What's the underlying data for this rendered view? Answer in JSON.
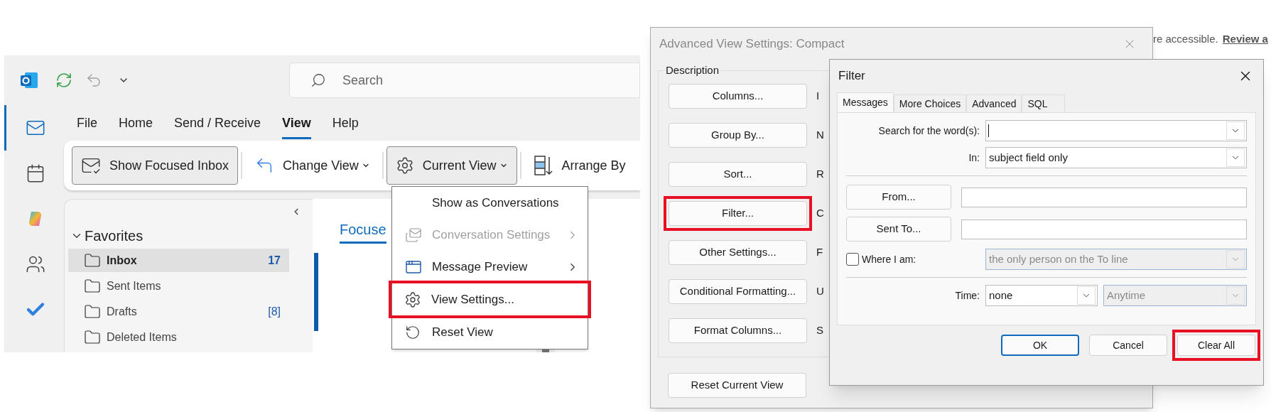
{
  "outlook": {
    "search": {
      "placeholder": "Search"
    },
    "nav_rail": [
      {
        "kind": "mail",
        "selected": true
      },
      {
        "kind": "calendar",
        "selected": false
      },
      {
        "kind": "copilot",
        "selected": false
      },
      {
        "kind": "people",
        "selected": false
      },
      {
        "kind": "todo",
        "selected": false
      }
    ],
    "menu_tabs": [
      {
        "label": "File",
        "selected": false
      },
      {
        "label": "Home",
        "selected": false
      },
      {
        "label": "Send / Receive",
        "selected": false
      },
      {
        "label": "View",
        "selected": true
      },
      {
        "label": "Help",
        "selected": false
      }
    ],
    "ribbon": [
      {
        "label": "Show Focused Inbox",
        "dropdown": false,
        "on": true
      },
      {
        "label": "Change View",
        "dropdown": true,
        "on": false
      },
      {
        "label": "Current View",
        "dropdown": true,
        "on": true
      },
      {
        "label": "Arrange By",
        "dropdown": false,
        "on": false
      }
    ],
    "folders": {
      "group": "Favorites",
      "expanded": true,
      "items": [
        {
          "name": "Inbox",
          "count": "17",
          "selected": true
        },
        {
          "name": "Sent Items",
          "selected": false
        },
        {
          "name": "Drafts",
          "count": "[8]",
          "selected": false
        },
        {
          "name": "Deleted Items",
          "selected": false
        }
      ]
    },
    "message_list": {
      "tab": "Focuse"
    },
    "current_view_menu": [
      {
        "label": "Show as Conversations",
        "disabled": false,
        "submenu": false,
        "callout": false
      },
      {
        "label": "Conversation Settings",
        "disabled": true,
        "submenu": true,
        "callout": false
      },
      {
        "label": "Message Preview",
        "disabled": false,
        "submenu": true,
        "callout": false
      },
      {
        "label": "View Settings...",
        "disabled": false,
        "submenu": false,
        "callout": true
      },
      {
        "label": "Reset View",
        "disabled": false,
        "submenu": false,
        "callout": false
      }
    ]
  },
  "background_text": {
    "sentence": "re accessible.",
    "link": "Review a"
  },
  "advanced_view_settings": {
    "title": "Advanced View Settings: Compact",
    "group": "Description",
    "buttons": [
      {
        "label": "Columns...",
        "side_label": "I",
        "callout": false
      },
      {
        "label": "Group By...",
        "side_label": "N",
        "callout": false
      },
      {
        "label": "Sort...",
        "side_label": "R",
        "callout": false
      },
      {
        "label": "Filter...",
        "side_label": "C",
        "callout": true
      },
      {
        "label": "Other Settings...",
        "side_label": "F",
        "callout": false
      },
      {
        "label": "Conditional Formatting...",
        "side_label": "U",
        "callout": false
      },
      {
        "label": "Format Columns...",
        "side_label": "S",
        "callout": false
      }
    ],
    "reset_button": "Reset Current View"
  },
  "filter": {
    "title": "Filter",
    "tabs": [
      {
        "label": "Messages",
        "selected": true
      },
      {
        "label": "More Choices",
        "selected": false
      },
      {
        "label": "Advanced",
        "selected": false
      },
      {
        "label": "SQL",
        "selected": false
      }
    ],
    "search_words": {
      "label": "Search for the word(s):"
    },
    "in": {
      "label": "In:",
      "value": "subject field only"
    },
    "from_button": "From...",
    "sent_to_button": "Sent To...",
    "where_i_am": {
      "label": "Where I am:",
      "checked": false,
      "value": "the only person on the To line",
      "disabled": true
    },
    "time": {
      "label": "Time:",
      "value": "none",
      "range": "Anytime",
      "range_disabled": true
    },
    "buttons": [
      {
        "label": "OK",
        "default": true,
        "callout": false
      },
      {
        "label": "Cancel",
        "default": false,
        "callout": false
      },
      {
        "label": "Clear All",
        "default": false,
        "callout": true
      }
    ]
  }
}
